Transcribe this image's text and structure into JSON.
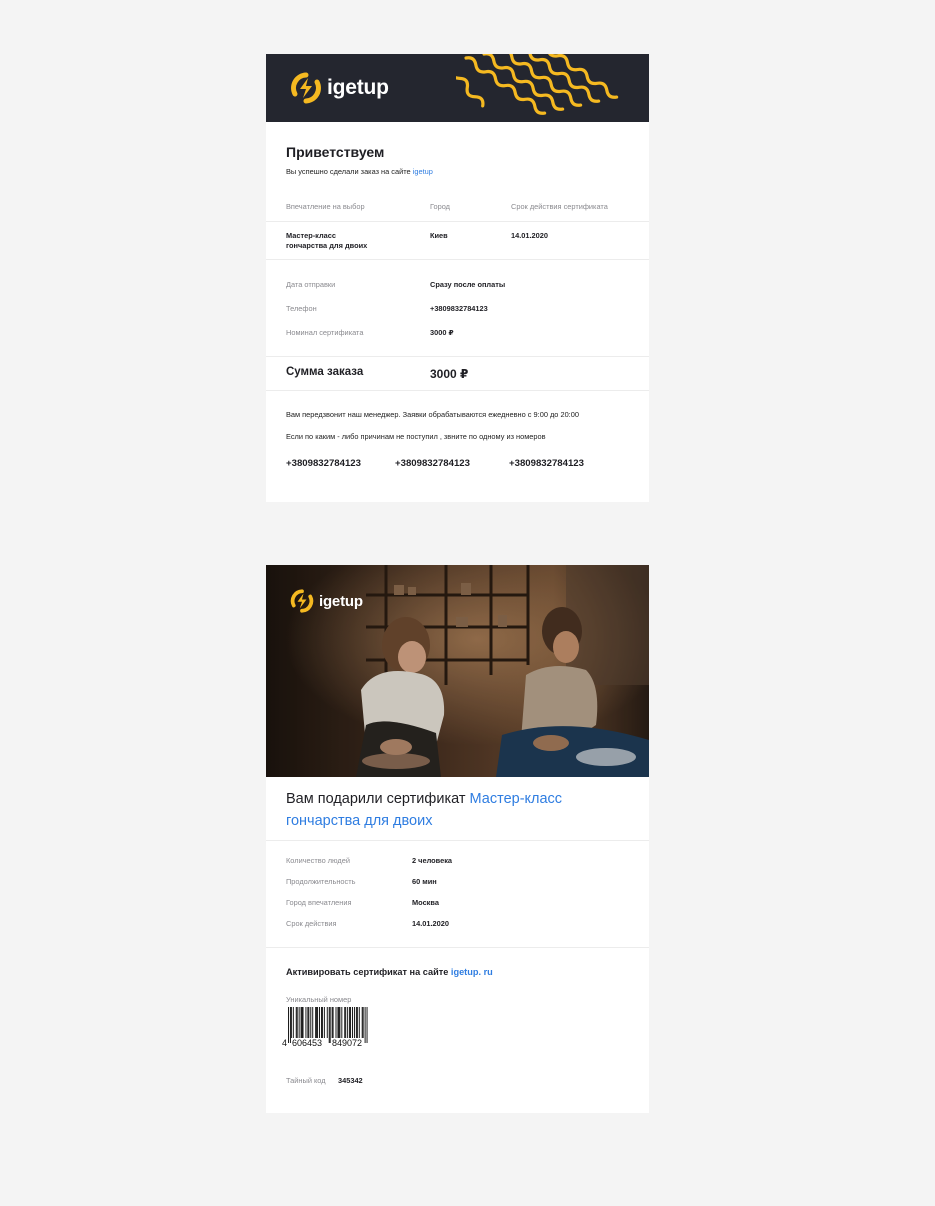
{
  "brand": {
    "name": "igetup",
    "accent": "#f5b921",
    "dark": "#24262f",
    "link_color": "#2f7de1"
  },
  "order_email": {
    "greeting": "Приветствуем",
    "intro_text": "Вы успешно сделали заказ на сайте",
    "intro_link": "igetup",
    "table_headers": [
      "Впечатление на выбор",
      "Город",
      "Срок действия сертификата"
    ],
    "table_row": {
      "experience_line1": "Мастер-класс",
      "experience_line2": "гончарства для двоих",
      "city": "Киев",
      "expiry": "14.01.2020"
    },
    "details": [
      {
        "label": "Дата отправки",
        "value": "Сразу после оплаты"
      },
      {
        "label": "Телефон",
        "value": "+3809832784123"
      },
      {
        "label": "Номинал сертификата",
        "value": "3000 ₽"
      }
    ],
    "sum_label": "Сумма заказа",
    "sum_value": "3000 ₽",
    "manager_note": "Вам передзвонит наш менеджер. Заявки обрабатываются ежедневно с 9:00 до 20:00",
    "fallback_note": "Если по каким - либо причинам не  поступил , звните по одному из номеров",
    "phones": [
      "+3809832784123",
      "+3809832784123",
      "+3809832784123"
    ]
  },
  "certificate": {
    "title_prefix": "Вам подарили сертификат",
    "title_highlight_line1": "Мастер-класс",
    "title_highlight_line2": "гончарства для двоих",
    "details": [
      {
        "label": "Количество людей",
        "value": "2 человека"
      },
      {
        "label": "Продолжительность",
        "value": "60 мин"
      },
      {
        "label": "Город впечатления",
        "value": "Москва"
      },
      {
        "label": "Срок действия",
        "value": "14.01.2020"
      }
    ],
    "activate_text": "Активировать сертификат на сайте",
    "activate_link": "igetup. ru",
    "unique_number_label": "Уникальный номер",
    "barcode_digits": {
      "first": "4",
      "left": "606453",
      "right": "849072"
    },
    "secret_code_label": "Тайный код",
    "secret_code_value": "345342"
  }
}
